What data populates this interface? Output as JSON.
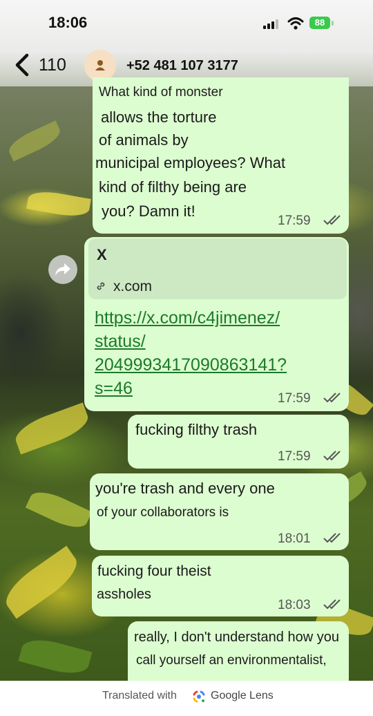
{
  "status_bar": {
    "time": "18:06",
    "battery": "88"
  },
  "header": {
    "back_count": "110",
    "contact": "+52 481 107 3177"
  },
  "messages": [
    {
      "lines": [
        "What kind of monster",
        "allows the torture",
        "of animals by",
        "municipal employees? What",
        "kind of filthy being are",
        "you? Damn it!"
      ],
      "time": "17:59"
    },
    {
      "preview_title": "X",
      "preview_domain": "x.com",
      "link_lines": [
        "https://x.com/c4jimenez/",
        "status/",
        "2049993417090863141?",
        "s=46"
      ],
      "time": "17:59"
    },
    {
      "lines": [
        "fucking filthy trash"
      ],
      "time": "17:59"
    },
    {
      "lines": [
        "you're trash and every one",
        "of your collaborators is"
      ],
      "time": "18:01"
    },
    {
      "lines": [
        "fucking four theist",
        "assholes"
      ],
      "time": "18:03"
    },
    {
      "lines": [
        "really, I don't understand how you",
        "call yourself an environmentalist,"
      ]
    }
  ],
  "footer": {
    "translated_with": "Translated with",
    "brand": "Google Lens"
  },
  "icons": [
    "back-chevron-icon",
    "avatar-person-icon",
    "link-icon",
    "forward-icon",
    "double-check-icon",
    "signal-icon",
    "wifi-icon",
    "battery-icon",
    "google-lens-icon"
  ],
  "colors": {
    "bubble": "#dcfdd0",
    "link": "#1a7a2a",
    "battery": "#3bc94c"
  }
}
